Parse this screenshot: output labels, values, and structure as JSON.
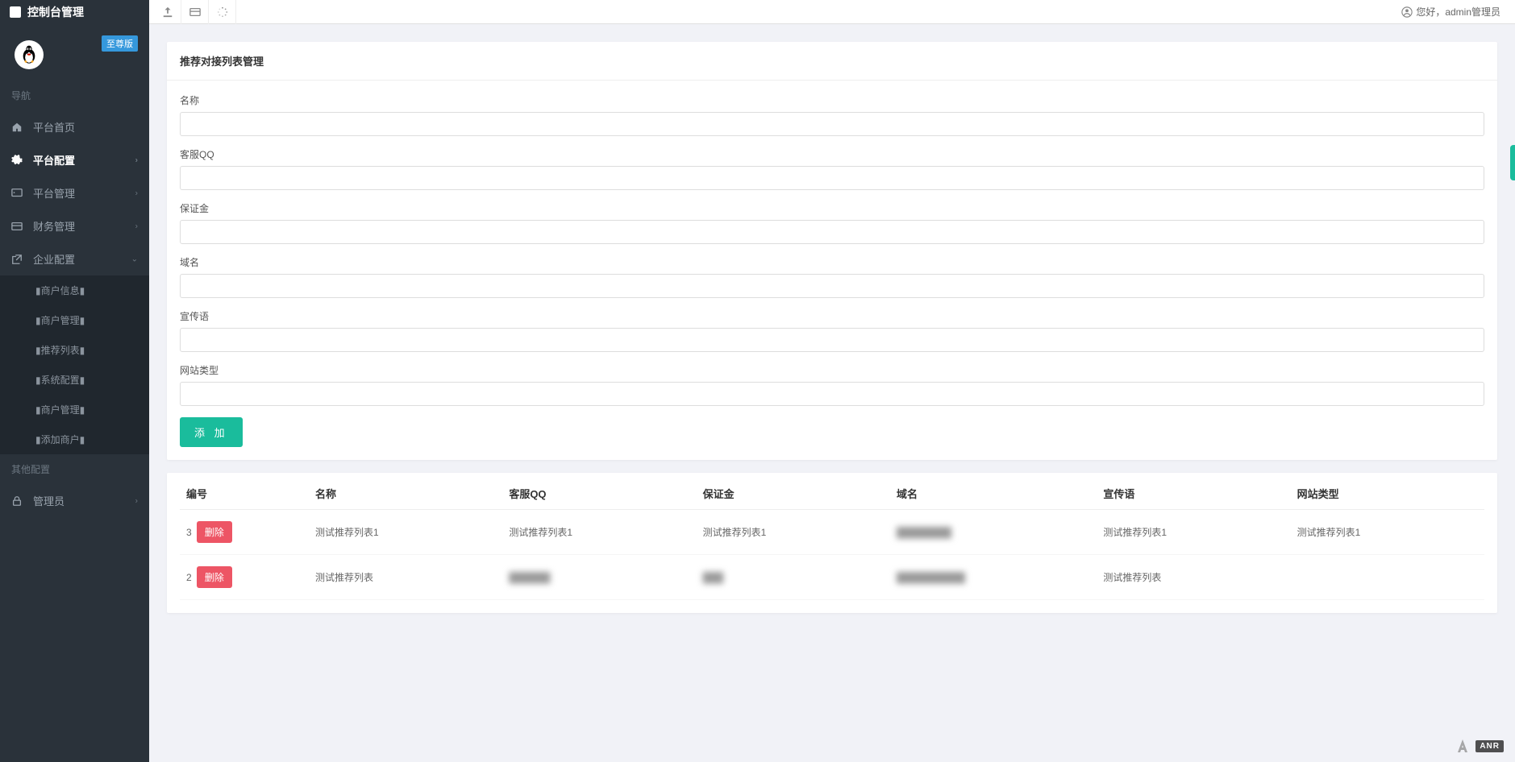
{
  "header": {
    "title": "控制台管理",
    "greeting": "您好，admin管理员"
  },
  "sidebar": {
    "version_badge": "至尊版",
    "section_nav": "导航",
    "section_other": "其他配置",
    "items": [
      {
        "label": "平台首页",
        "icon": "home"
      },
      {
        "label": "平台配置",
        "icon": "gear",
        "active": true,
        "expandable": true
      },
      {
        "label": "平台管理",
        "icon": "panel",
        "expandable": true
      },
      {
        "label": "财务管理",
        "icon": "card",
        "expandable": true
      },
      {
        "label": "企业配置",
        "icon": "external",
        "expandable": true,
        "expanded": true
      }
    ],
    "sub_items": [
      "▮商户信息▮",
      "▮商户管理▮",
      "▮推荐列表▮",
      "▮系统配置▮",
      "▮商户管理▮",
      "▮添加商户▮"
    ],
    "admin_item": "管理员"
  },
  "panel": {
    "title": "推荐对接列表管理"
  },
  "form": {
    "fields": [
      {
        "label": "名称"
      },
      {
        "label": "客服QQ"
      },
      {
        "label": "保证金"
      },
      {
        "label": "域名"
      },
      {
        "label": "宣传语"
      },
      {
        "label": "网站类型"
      }
    ],
    "submit_label": "添 加"
  },
  "table": {
    "headers": [
      "编号",
      "名称",
      "客服QQ",
      "保证金",
      "域名",
      "宣传语",
      "网站类型"
    ],
    "delete_label": "删除",
    "rows": [
      {
        "id": "3",
        "cols": [
          "测试推荐列表1",
          "测试推荐列表1",
          "测试推荐列表1",
          "████████",
          "测试推荐列表1",
          "测试推荐列表1"
        ],
        "blur": [
          false,
          false,
          false,
          true,
          false,
          false
        ]
      },
      {
        "id": "2",
        "cols": [
          "测试推荐列表",
          "██████",
          "███",
          "██████████",
          "测试推荐列表",
          ""
        ],
        "blur": [
          false,
          true,
          true,
          true,
          false,
          false
        ]
      }
    ]
  },
  "watermark": {
    "text": "ANR"
  }
}
